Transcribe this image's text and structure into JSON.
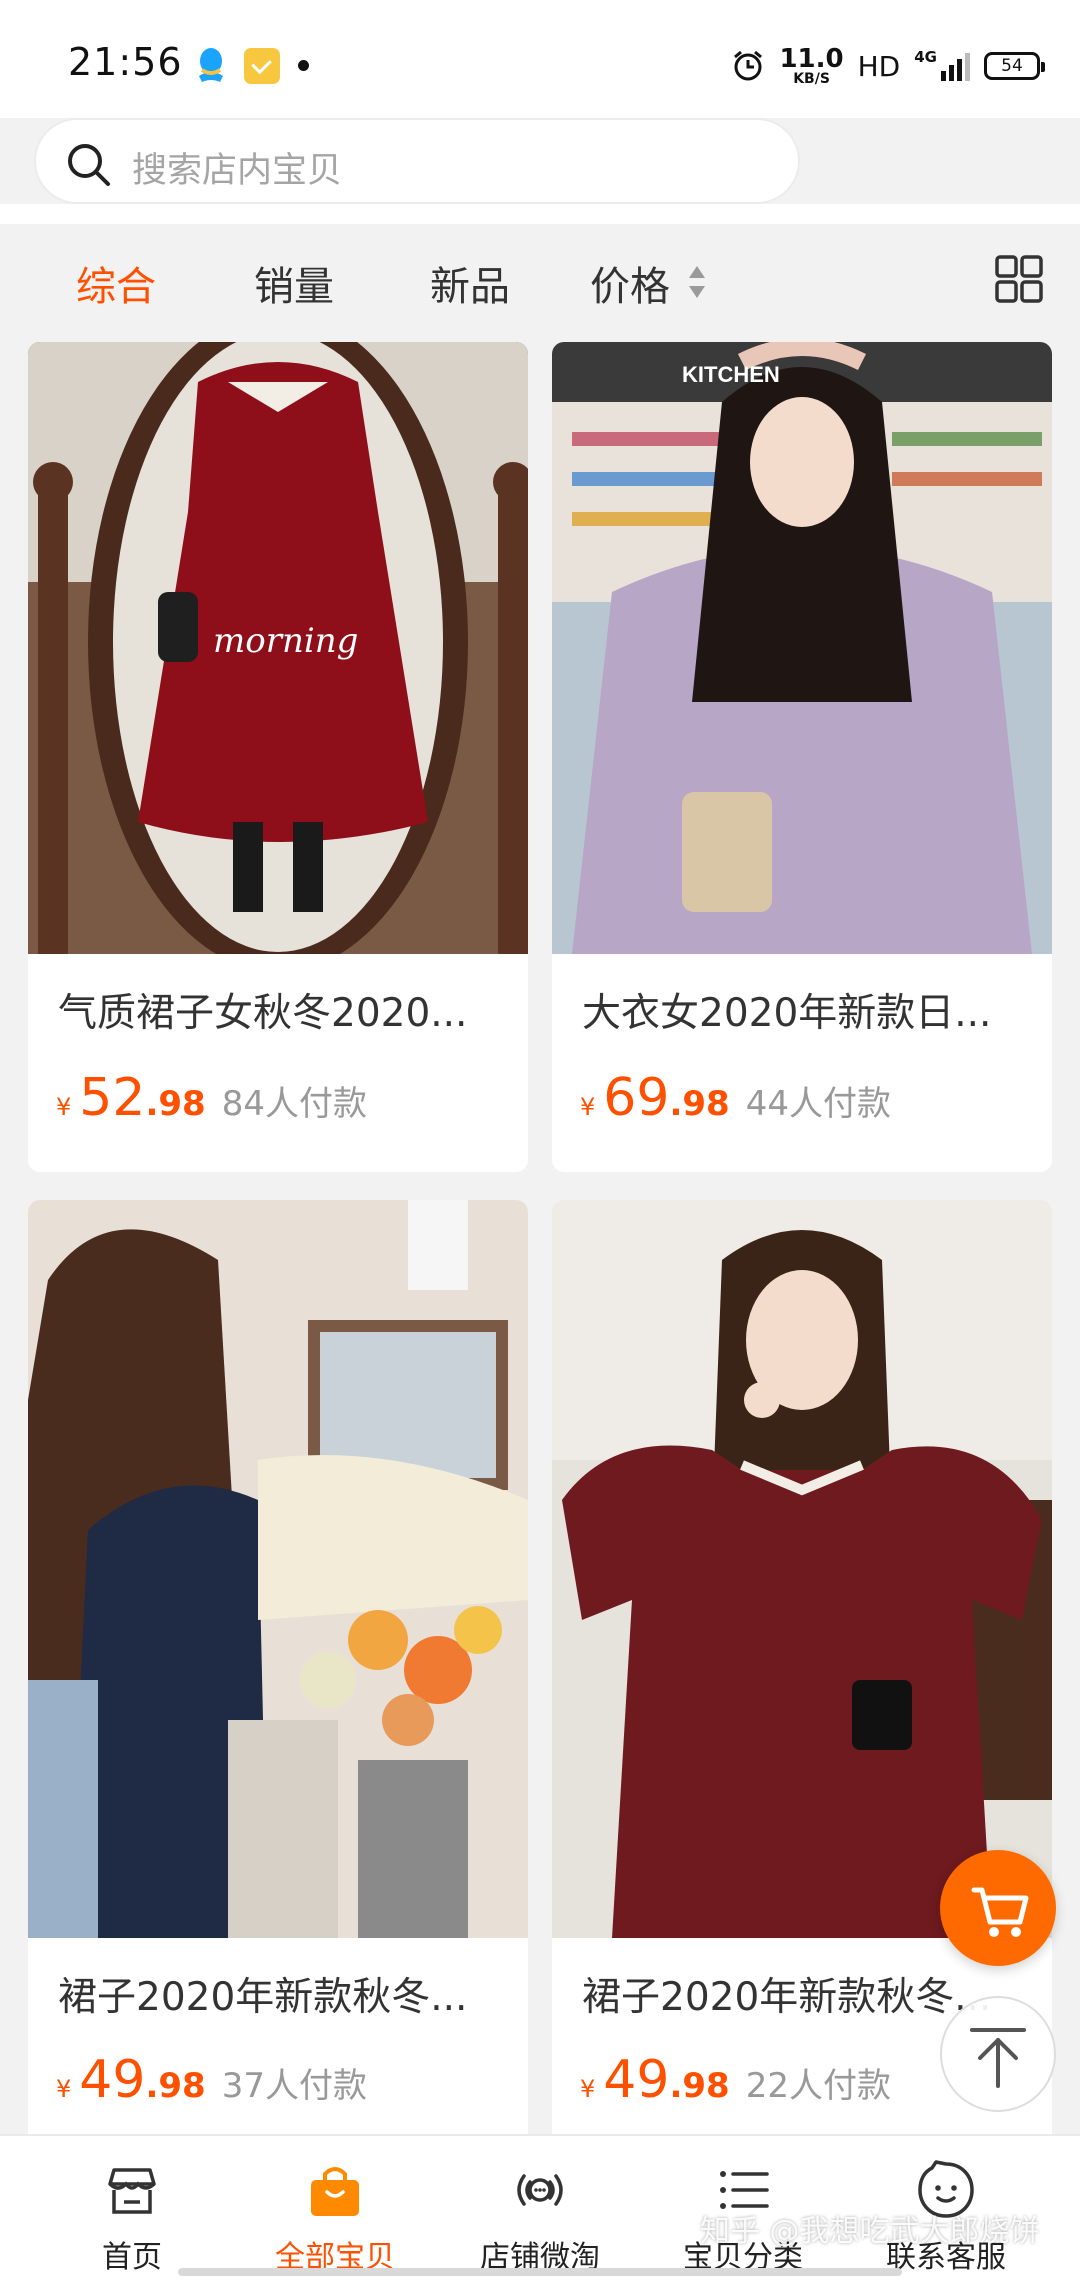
{
  "status_bar": {
    "time": "21:56",
    "net_speed": "11.0",
    "net_speed_unit": "KB/S",
    "hd": "HD",
    "network": "4G",
    "battery": "54",
    "icons": [
      "qq-icon",
      "card-icon",
      "dot-icon",
      "alarm-icon",
      "signal-icon",
      "battery-icon"
    ]
  },
  "search": {
    "placeholder": "搜索店内宝贝"
  },
  "sort_tabs": [
    {
      "label": "综合",
      "active": true
    },
    {
      "label": "销量"
    },
    {
      "label": "新品"
    },
    {
      "label": "价格"
    }
  ],
  "products": [
    {
      "title": "气质裙子女秋冬2020...",
      "currency": "¥",
      "price_int": "52",
      "price_dec": ".98",
      "sold": "84人付款"
    },
    {
      "title": "大衣女2020年新款日...",
      "currency": "¥",
      "price_int": "69",
      "price_dec": ".98",
      "sold": "44人付款"
    },
    {
      "title": "裙子2020年新款秋冬...",
      "currency": "¥",
      "price_int": "49",
      "price_dec": ".98",
      "sold": "37人付款"
    },
    {
      "title": "裙子2020年新款秋冬...",
      "currency": "¥",
      "price_int": "49",
      "price_dec": ".98",
      "sold": "22人付款"
    }
  ],
  "product_photo_text": {
    "mirror_script": "morning",
    "store_sign": "KITCHEN"
  },
  "bottom_nav": [
    {
      "label": "首页",
      "icon": "store-icon"
    },
    {
      "label": "全部宝贝",
      "icon": "shopping-bag-icon",
      "active": true
    },
    {
      "label": "店铺微淘",
      "icon": "broadcast-icon"
    },
    {
      "label": "宝贝分类",
      "icon": "list-icon"
    },
    {
      "label": "联系客服",
      "icon": "chat-face-icon"
    }
  ],
  "watermark": "知乎 @我想吃武大郎烧饼",
  "colors": {
    "accent": "#ff5000",
    "background": "#f2f2f2",
    "cart_button": "#ff6a00"
  }
}
